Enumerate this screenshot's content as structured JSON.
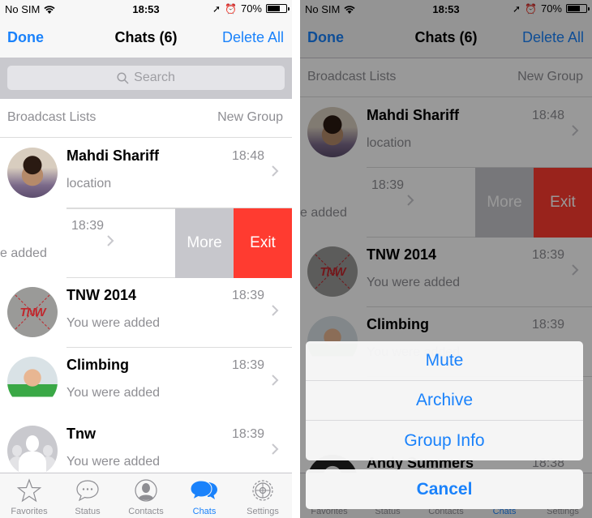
{
  "status_bar": {
    "carrier": "No SIM",
    "time": "18:53",
    "battery": "70%",
    "battery_level": 0.7
  },
  "nav": {
    "done": "Done",
    "title": "Chats (6)",
    "delete_all": "Delete All"
  },
  "search": {
    "placeholder": "Search"
  },
  "list_header": {
    "broadcast_lists": "Broadcast Lists",
    "new_group": "New Group"
  },
  "chats": [
    {
      "name": "Mahdi Shariff",
      "time": "18:48",
      "message": "location"
    },
    {
      "name": "",
      "time": "18:39",
      "message": "You were added",
      "message_visible": "e added"
    },
    {
      "name": "TNW 2014",
      "time": "18:39",
      "message": "You were added"
    },
    {
      "name": "Climbing",
      "time": "18:39",
      "message": "You were added"
    },
    {
      "name": "Tnw",
      "time": "18:39",
      "message": "You were added"
    },
    {
      "name": "Andy Summers",
      "time": "18:38",
      "message": ""
    }
  ],
  "swipe_actions": {
    "more": "More",
    "exit": "Exit"
  },
  "tabs": [
    {
      "label": "Favorites",
      "icon": "star-icon",
      "active": false
    },
    {
      "label": "Status",
      "icon": "speech-bubble-icon",
      "active": false
    },
    {
      "label": "Contacts",
      "icon": "contact-silhouette-icon",
      "active": false
    },
    {
      "label": "Chats",
      "icon": "chats-bubbles-icon",
      "active": true
    },
    {
      "label": "Settings",
      "icon": "gear-icon",
      "active": false
    }
  ],
  "action_sheet": {
    "items": [
      "Mute",
      "Archive",
      "Group Info"
    ],
    "cancel": "Cancel"
  },
  "colors": {
    "accent": "#1a82fb",
    "destructive": "#ff3b30",
    "more_action": "#c7c7cc"
  }
}
